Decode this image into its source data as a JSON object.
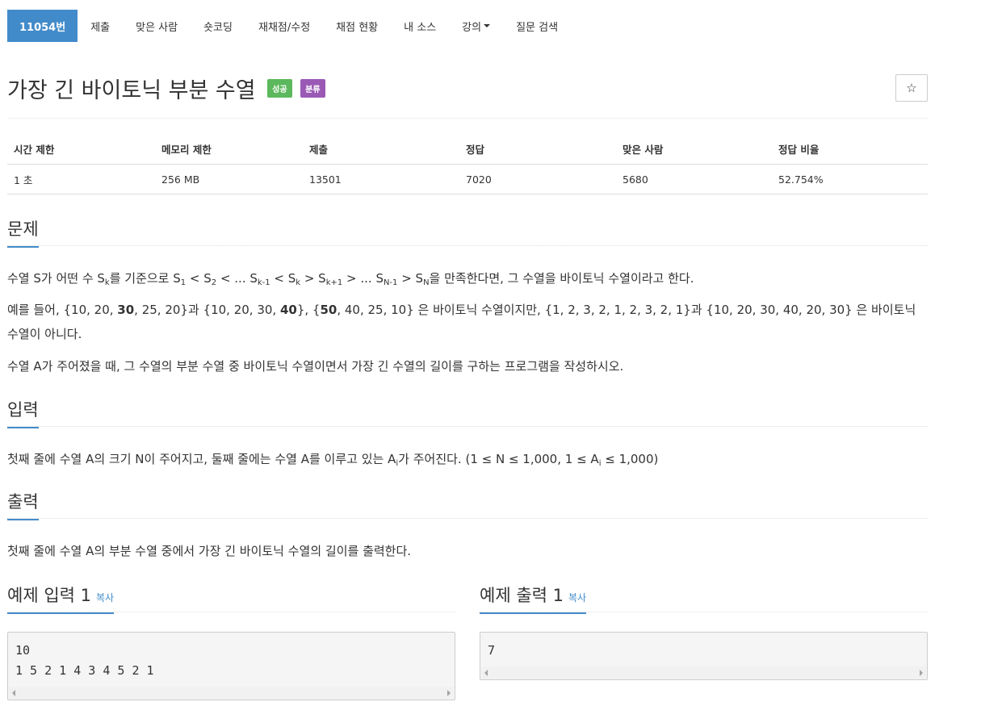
{
  "nav": {
    "problem_number": "11054번",
    "tabs": [
      "제출",
      "맞은 사람",
      "숏코딩",
      "재채점/수정",
      "채점 현황",
      "내 소스",
      "강의",
      "질문 검색"
    ]
  },
  "problem": {
    "title": "가장 긴 바이토닉 부분 수열",
    "badge_success": "성공",
    "badge_category": "분류",
    "star_icon": "☆"
  },
  "info_table": {
    "headers": [
      "시간 제한",
      "메모리 제한",
      "제출",
      "정답",
      "맞은 사람",
      "정답 비율"
    ],
    "values": [
      "1 초",
      "256 MB",
      "13501",
      "7020",
      "5680",
      "52.754%"
    ]
  },
  "sections": {
    "description_title": "문제",
    "description": {
      "line1": {
        "a": "수열 S가 어떤 수 S",
        "a_sub": "k",
        "b": "를 기준으로 S",
        "b_sub": "1",
        "c": " < S",
        "c_sub": "2",
        "d": " < ... S",
        "d_sub": "k-1",
        "e": " < S",
        "e_sub": "k",
        "f": " > S",
        "f_sub": "k+1",
        "g": " > ... S",
        "g_sub": "N-1",
        "h": " > S",
        "h_sub": "N",
        "i": "을 만족한다면, 그 수열을 바이토닉 수열이라고 한다."
      },
      "line2": {
        "a": "예를 들어, {10, 20, ",
        "a_bold": "30",
        "b": ", 25, 20}과 {10, 20, 30, ",
        "b_bold": "40",
        "c": "}, {",
        "c_bold": "50",
        "d": ", 40, 25, 10} 은 바이토닉 수열이지만,  {1, 2, 3, 2, 1, 2, 3, 2, 1}과 {10, 20, 30, 40, 20, 30} 은 바이토닉 수열이 아니다."
      },
      "line3": "수열 A가 주어졌을 때, 그 수열의 부분 수열 중 바이토닉 수열이면서 가장 긴 수열의 길이를 구하는 프로그램을 작성하시오."
    },
    "input_title": "입력",
    "input": {
      "a": "첫째 줄에 수열 A의 크기 N이 주어지고, 둘째 줄에는 수열 A를 이루고 있는 A",
      "a_sub": "i",
      "b": "가 주어진다. (1 ≤ N ≤ 1,000, 1 ≤ A",
      "b_sub": "i",
      "c": " ≤ 1,000)"
    },
    "output_title": "출력",
    "output": "첫째 줄에 수열 A의 부분 수열 중에서 가장 긴 바이토닉 수열의 길이를 출력한다."
  },
  "samples": {
    "input_title": "예제 입력 1",
    "output_title": "예제 출력 1",
    "copy_label": "복사",
    "input_text": "10\n1 5 2 1 4 3 4 5 2 1",
    "output_text": "7"
  }
}
